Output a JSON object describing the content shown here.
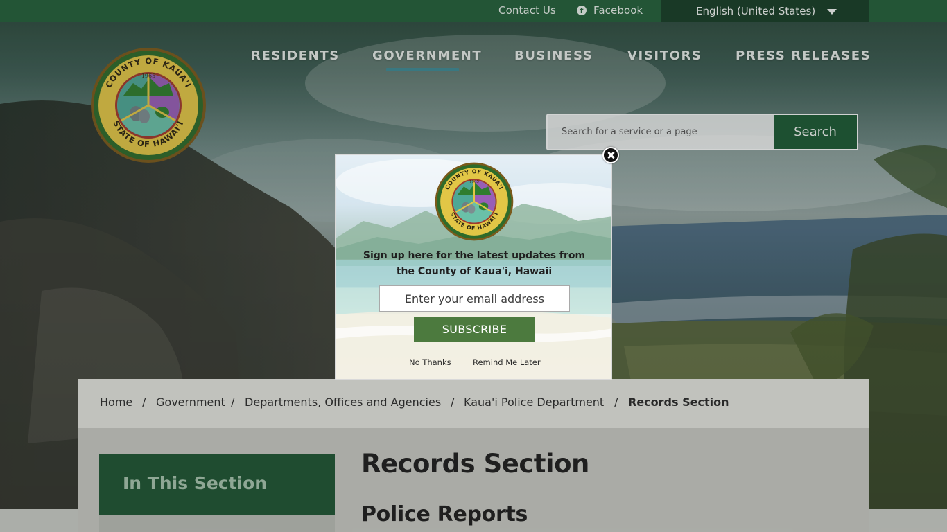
{
  "topbar": {
    "contact_label": "Contact Us",
    "facebook_label": "Facebook",
    "language_selected": "English (United States)"
  },
  "nav": {
    "items": [
      {
        "label": "RESIDENTS"
      },
      {
        "label": "GOVERNMENT",
        "active": true
      },
      {
        "label": "BUSINESS"
      },
      {
        "label": "VISITORS"
      },
      {
        "label": "PRESS RELEASES"
      }
    ]
  },
  "logo": {
    "ring_top": "COUNTY OF KAUA'I",
    "ring_bottom": "STATE OF HAWAI'I",
    "year": "1965"
  },
  "search": {
    "placeholder": "Search for a service or a page",
    "button_label": "Search"
  },
  "breadcrumb": {
    "items": [
      {
        "label": "Home"
      },
      {
        "label": "Government"
      },
      {
        "label": "Departments, Offices and Agencies"
      },
      {
        "label": "Kaua'i Police Department"
      },
      {
        "label": "Records Section",
        "current": true
      }
    ],
    "separator": "/"
  },
  "sidebar": {
    "section_label": "In This Section"
  },
  "main": {
    "page_title": "Records Section",
    "sub_title": "Police Reports"
  },
  "modal": {
    "message": "Sign up here for the latest updates from the County of Kaua'i, Hawaii",
    "email_placeholder": "Enter your email address",
    "subscribe_label": "SUBSCRIBE",
    "no_thanks_label": "No Thanks",
    "remind_label": "Remind Me Later"
  },
  "colors": {
    "brand_green": "#23603a",
    "dark_green": "#163d27",
    "accent_teal": "#3d8a95",
    "subscribe_green": "#4c7a3e"
  }
}
